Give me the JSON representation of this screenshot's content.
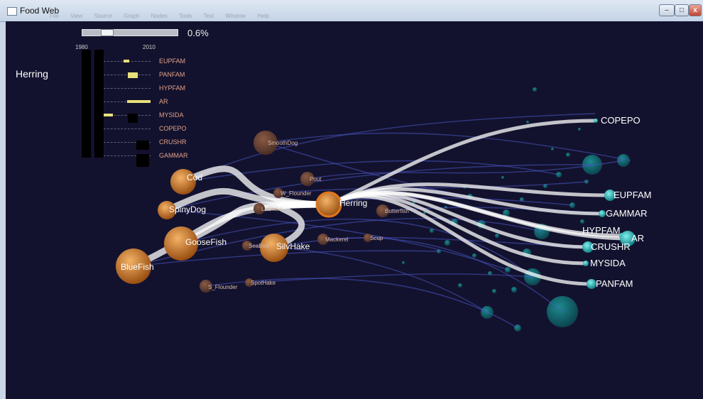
{
  "window": {
    "title": "Food Web",
    "menu": [
      "File",
      "View",
      "Source",
      "Graph",
      "Nodes",
      "Tools",
      "Test",
      "Window",
      "Help"
    ],
    "close_label": "x"
  },
  "timeline": {
    "value_label": "0.6%",
    "position": 0.22
  },
  "panel": {
    "species": "Herring",
    "year_start": "1980",
    "year_end": "2010",
    "prey": [
      {
        "label": "EUPFAM",
        "bar_start": 0.42,
        "bar_end": 0.54,
        "dark_height": 0
      },
      {
        "label": "PANFAM",
        "bar_start": 0.52,
        "bar_end": 0.72,
        "dark_height": 0
      },
      {
        "label": "HYPFAM",
        "bar_start": 0,
        "bar_end": 0,
        "dark_height": 0
      },
      {
        "label": "AR",
        "bar_start": 0.5,
        "bar_end": 1.0,
        "dark_height": 0
      },
      {
        "label": "MYSIDA",
        "bar_start": 0.0,
        "bar_end": 0.2,
        "dark_height": 0.9
      },
      {
        "label": "COPEPO",
        "bar_start": 0,
        "bar_end": 0,
        "dark_height": 0
      },
      {
        "label": "CRUSHR",
        "bar_start": 0,
        "bar_end": 0,
        "dark_height": 0.9
      },
      {
        "label": "GAMMAR",
        "bar_start": 0,
        "bar_end": 0,
        "dark_height": 1.3
      }
    ]
  },
  "colors": {
    "predator": "#d8842c",
    "minor": "#7a4e3c",
    "prey": "#27c2c0",
    "link": "#ffffff",
    "background": "#13122e",
    "focus_ring": "#e0761c"
  },
  "chart_data": {
    "type": "network",
    "focus": "Herring",
    "nodes": [
      {
        "id": "Herring",
        "group": "focus"
      },
      {
        "id": "Cod",
        "group": "predator"
      },
      {
        "id": "SpinyDog",
        "group": "predator"
      },
      {
        "id": "GooseFish",
        "group": "predator"
      },
      {
        "id": "BlueFish",
        "group": "predator"
      },
      {
        "id": "SilvHake",
        "group": "predator"
      },
      {
        "id": "SmoothDog",
        "group": "minor"
      },
      {
        "id": "Pout",
        "group": "minor"
      },
      {
        "id": "W_Flounder",
        "group": "minor"
      },
      {
        "id": "LoSkate",
        "group": "minor"
      },
      {
        "id": "Butterfish",
        "group": "minor"
      },
      {
        "id": "Mackerel",
        "group": "minor"
      },
      {
        "id": "Scup",
        "group": "minor"
      },
      {
        "id": "SeaBird",
        "group": "minor"
      },
      {
        "id": "SpotHake",
        "group": "minor"
      },
      {
        "id": "S_Flounder",
        "group": "minor"
      },
      {
        "id": "COPEPO",
        "group": "prey"
      },
      {
        "id": "EUPFAM",
        "group": "prey"
      },
      {
        "id": "GAMMAR",
        "group": "prey"
      },
      {
        "id": "HYPFAM",
        "group": "prey"
      },
      {
        "id": "AR",
        "group": "prey"
      },
      {
        "id": "CRUSHR",
        "group": "prey"
      },
      {
        "id": "MYSIDA",
        "group": "prey"
      },
      {
        "id": "PANFAM",
        "group": "prey"
      }
    ],
    "links": [
      {
        "source": "Cod",
        "target": "Herring"
      },
      {
        "source": "SpinyDog",
        "target": "Herring"
      },
      {
        "source": "GooseFish",
        "target": "Herring"
      },
      {
        "source": "BlueFish",
        "target": "Herring"
      },
      {
        "source": "SilvHake",
        "target": "Herring"
      },
      {
        "source": "Herring",
        "target": "COPEPO"
      },
      {
        "source": "Herring",
        "target": "EUPFAM"
      },
      {
        "source": "Herring",
        "target": "GAMMAR"
      },
      {
        "source": "Herring",
        "target": "HYPFAM"
      },
      {
        "source": "Herring",
        "target": "AR"
      },
      {
        "source": "Herring",
        "target": "CRUSHR"
      },
      {
        "source": "Herring",
        "target": "MYSIDA"
      },
      {
        "source": "Herring",
        "target": "PANFAM"
      }
    ]
  }
}
